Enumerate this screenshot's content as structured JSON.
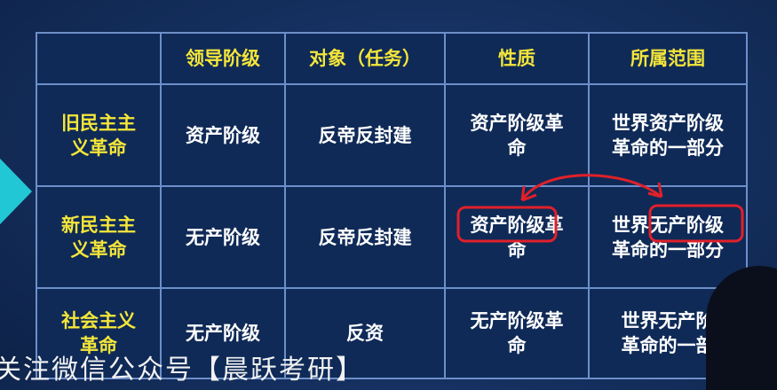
{
  "table": {
    "headers": [
      "",
      "领导阶级",
      "对象（任务）",
      "性质",
      "所属范围"
    ],
    "rows": [
      {
        "label": "旧民主主义革命",
        "label_lines": [
          "旧民主主",
          "义革命"
        ],
        "leader": "资产阶级",
        "target": "反帝反封建",
        "nature_lines": [
          "资产阶级革",
          "命"
        ],
        "scope_lines": [
          "世界资产阶级",
          "革命的一部分"
        ]
      },
      {
        "label": "新民主主义革命",
        "label_lines": [
          "新民主主",
          "义革命"
        ],
        "leader": "无产阶级",
        "target": "反帝反封建",
        "nature_lines": [
          "资产阶级革",
          "命"
        ],
        "scope_lines": [
          "世界无产阶级",
          "革命的一部分"
        ]
      },
      {
        "label": "社会主义革命",
        "label_lines": [
          "社会主义",
          "革命"
        ],
        "leader": "无产阶级",
        "target": "反资",
        "nature_lines": [
          "无产阶级革",
          "命"
        ],
        "scope_lines": [
          "世界无产阶",
          "革命的一部"
        ]
      }
    ]
  },
  "overlay_caption": "关注微信公众号【晨跃考研】",
  "colors": {
    "header_text": "#f4e63a",
    "cell_text": "#ffffff",
    "cell_bg": "#0f2a57",
    "border": "#6d8fc9",
    "annotation": "#e0202a",
    "accent": "#22c7d6"
  }
}
